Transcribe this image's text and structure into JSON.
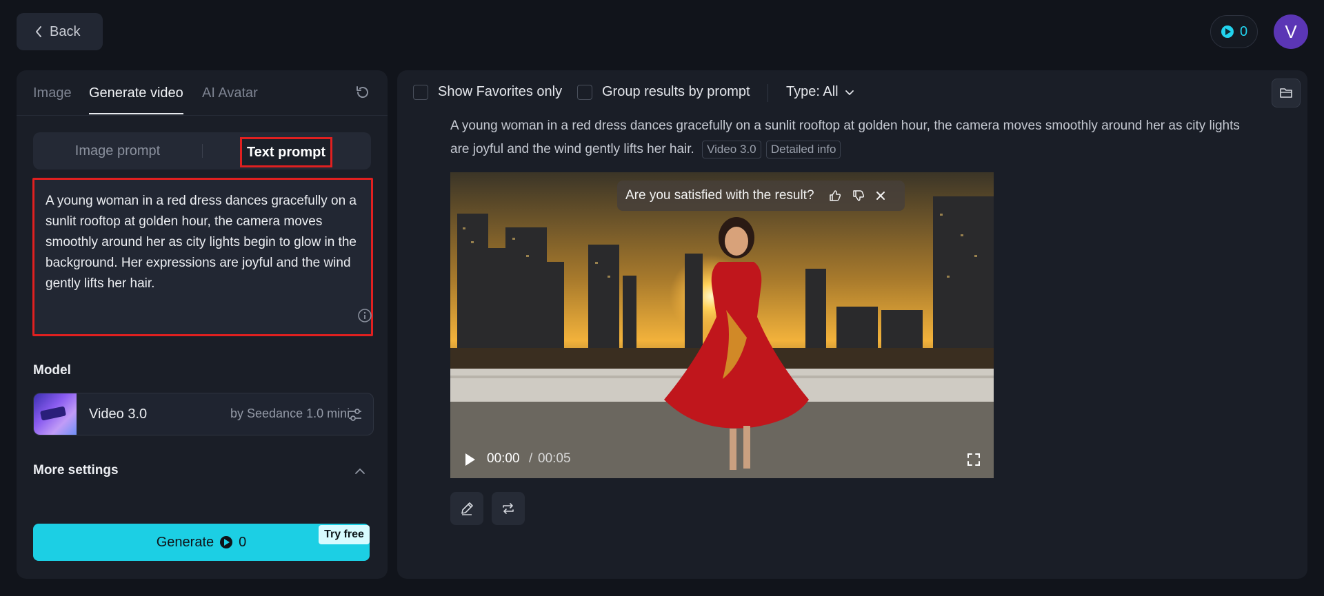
{
  "topbar": {
    "back_label": "Back",
    "credits": "0",
    "avatar_letter": "V"
  },
  "left_panel": {
    "tabs": [
      {
        "label": "Image"
      },
      {
        "label": "Generate video"
      },
      {
        "label": "AI Avatar"
      }
    ],
    "prompt_modes": {
      "image_prompt": "Image prompt",
      "text_prompt": "Text prompt"
    },
    "prompt_text": "A young woman in a red dress dances gracefully on a sunlit rooftop at golden hour, the camera moves smoothly around her as city lights begin to glow in the background. Her expressions are joyful and the wind gently lifts her hair.",
    "model": {
      "section_label": "Model",
      "name": "Video 3.0",
      "provider": "by Seedance 1.0 mini"
    },
    "more_settings_label": "More settings",
    "generate": {
      "label": "Generate",
      "cost": "0",
      "try_free": "Try free"
    }
  },
  "right_panel": {
    "filters": {
      "favorites_label": "Show Favorites only",
      "group_label": "Group results by prompt",
      "type_label": "Type: All"
    },
    "result": {
      "prompt_line1": "A young woman in a red dress dances gracefully on a sunlit rooftop at golden hour, the camera moves smoothly around her as city lights",
      "prompt_line2": "are joyful and the wind gently lifts her hair.",
      "model_badge": "Video 3.0",
      "info_badge": "Detailed info",
      "survey_question": "Are you satisfied with the result?",
      "time_current": "00:00",
      "time_separator": "/",
      "time_total": "00:05"
    }
  },
  "colors": {
    "accent": "#1ccfe4",
    "highlight": "#e02020",
    "background": "#11141b",
    "panel": "#1a1e27",
    "avatar": "#5b36b5"
  }
}
